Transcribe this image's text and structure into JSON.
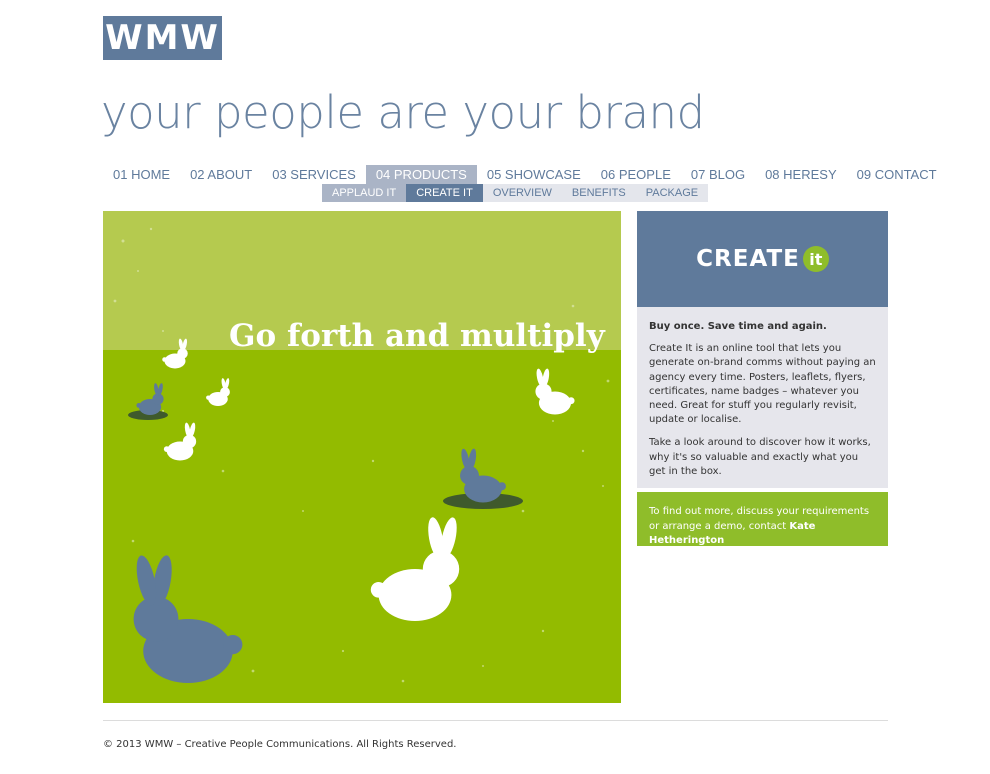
{
  "brand": {
    "logo_text": "WMW",
    "tagline": "your people are your brand"
  },
  "main_nav": [
    {
      "label": "01 HOME"
    },
    {
      "label": "02 ABOUT"
    },
    {
      "label": "03 SERVICES"
    },
    {
      "label": "04 PRODUCTS",
      "active": true
    },
    {
      "label": "05 SHOWCASE"
    },
    {
      "label": "06 PEOPLE"
    },
    {
      "label": "07 BLOG"
    },
    {
      "label": "08 HERESY"
    },
    {
      "label": "09 CONTACT"
    }
  ],
  "sub_nav": [
    {
      "label": "APPLAUD IT"
    },
    {
      "label": "CREATE IT",
      "current": true
    },
    {
      "label": "OVERVIEW"
    },
    {
      "label": "BENEFITS"
    },
    {
      "label": "PACKAGE"
    }
  ],
  "hero": {
    "title": "Go forth and multiply"
  },
  "sidebar": {
    "product_logo_word": "CREATE",
    "product_logo_badge": "it",
    "lead": "Buy once. Save time and again.",
    "paragraph_1": "Create It is an online tool that lets you generate on-brand comms without paying an agency every time. Posters, leaflets, flyers, certificates, name badges – whatever you need. Great for stuff you regularly revisit, update or localise.",
    "paragraph_2": "Take a look around to discover how it works, why it's so valuable and exactly what you get in the box.",
    "cta_text": "To find out more, discuss your requirements or arrange a demo, contact ",
    "cta_contact": "Kate Hetherington"
  },
  "footer": {
    "copyright": "© 2013 WMW – Creative People Communications. All Rights Reserved."
  },
  "colors": {
    "brand_blue": "#5f7a9b",
    "lime_light": "#b5ca4f",
    "lime": "#93bb00",
    "cta_green": "#8fbd2a"
  },
  "icons": {
    "rabbit": "rabbit-illustration",
    "badge": "it-circle-badge"
  }
}
